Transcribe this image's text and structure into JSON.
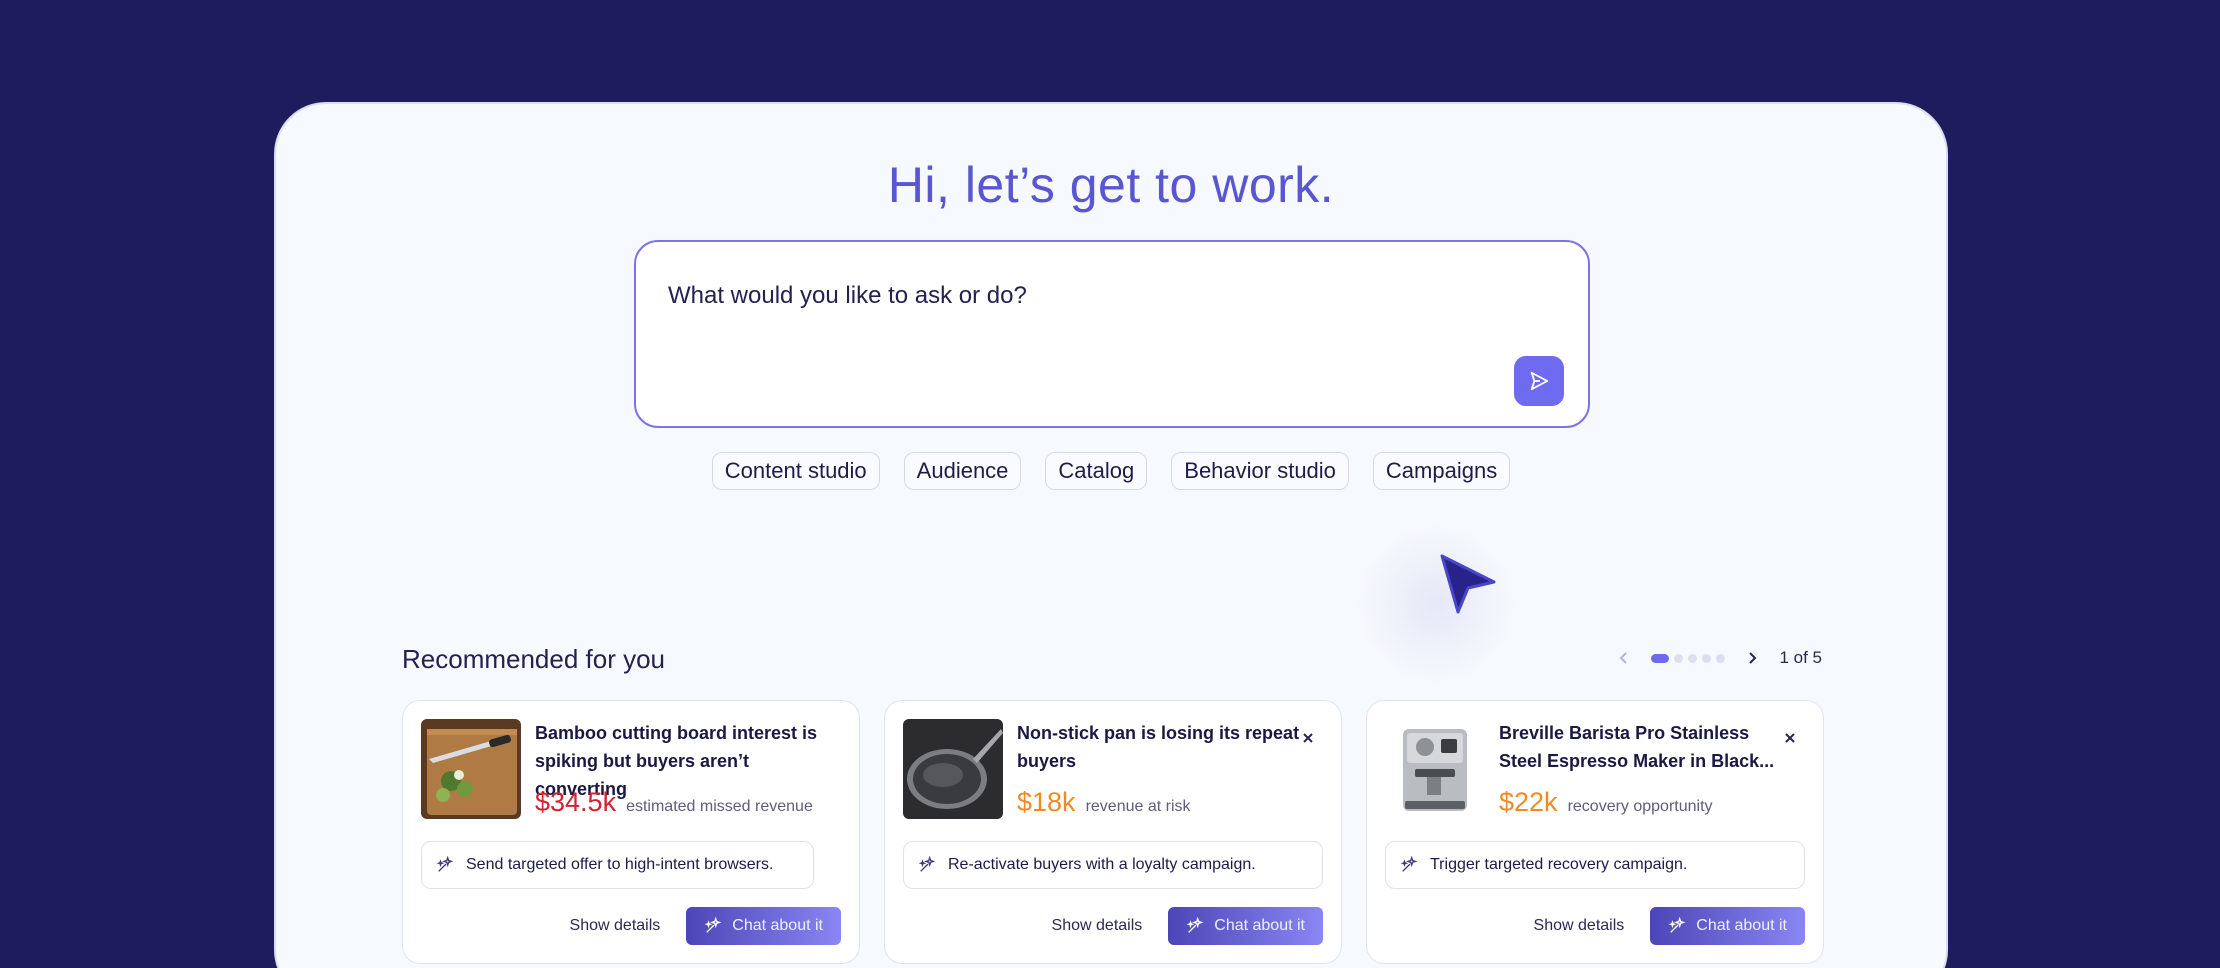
{
  "greeting": "Hi, let’s get to work.",
  "prompt": {
    "placeholder": "What would you like to ask or do?"
  },
  "chips": [
    "Content studio",
    "Audience",
    "Catalog",
    "Behavior studio",
    "Campaigns"
  ],
  "recommended": {
    "title": "Recommended for you",
    "page_label": "1 of 5",
    "pages_total": 5,
    "current_page": 1,
    "cards": [
      {
        "title": "Bamboo cutting board interest is spiking but buyers aren’t converting",
        "image": "cutting-board-photo",
        "metric_value": "$34.5k",
        "metric_label": "estimated missed revenue",
        "metric_color": "#d2232f",
        "action": "Send targeted offer to high-intent browsers.",
        "show_details": "Show details",
        "chat_label": "Chat about it"
      },
      {
        "title": "Non-stick pan is losing its repeat buyers",
        "image": "frying-pan-photo",
        "metric_value": "$18k",
        "metric_label": "revenue at risk",
        "metric_color": "#f08a24",
        "action": "Re-activate buyers with a loyalty campaign.",
        "show_details": "Show details",
        "chat_label": "Chat about it"
      },
      {
        "title": "Breville Barista Pro Stainless Steel Espresso Maker in Black...",
        "image": "espresso-machine-photo",
        "metric_value": "$22k",
        "metric_label": "recovery opportunity",
        "metric_color": "#f08a24",
        "action": "Trigger targeted recovery campaign.",
        "show_details": "Show details",
        "chat_label": "Chat about it"
      }
    ]
  },
  "colors": {
    "background": "#1f1c5e",
    "accent": "#6f6bf0",
    "greeting": "#5a55d0"
  }
}
